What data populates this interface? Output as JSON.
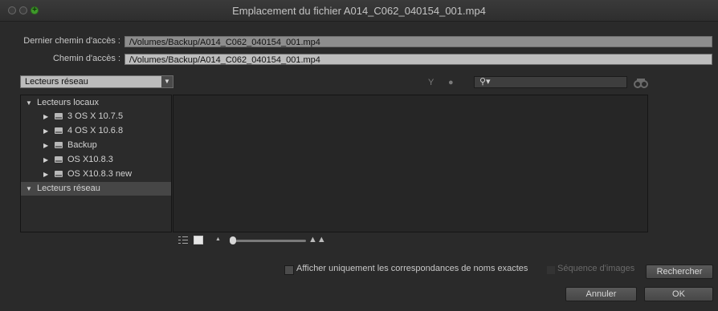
{
  "window": {
    "title": "Emplacement du fichier A014_C062_040154_001.mp4"
  },
  "paths": {
    "last_path_label": "Dernier chemin d'accès :",
    "last_path_value": "/Volumes/Backup/A014_C062_040154_001.mp4",
    "path_label": "Chemin d'accès :",
    "path_value": "/Volumes/Backup/A014_C062_040154_001.mp4"
  },
  "location_dropdown": {
    "selected": "Lecteurs réseau"
  },
  "search": {
    "placeholder": ""
  },
  "tree": {
    "local_section": "Lecteurs locaux",
    "drives": [
      "3 OS X 10.7.5",
      "4 OS X 10.6.8",
      "Backup",
      "OS X10.8.3",
      "OS X10.8.3 new"
    ],
    "network_section": "Lecteurs réseau"
  },
  "options": {
    "exact_match_label": "Afficher uniquement les correspondances de noms exactes",
    "image_sequence_label": "Séquence d'images"
  },
  "buttons": {
    "search": "Rechercher",
    "cancel": "Annuler",
    "ok": "OK"
  }
}
